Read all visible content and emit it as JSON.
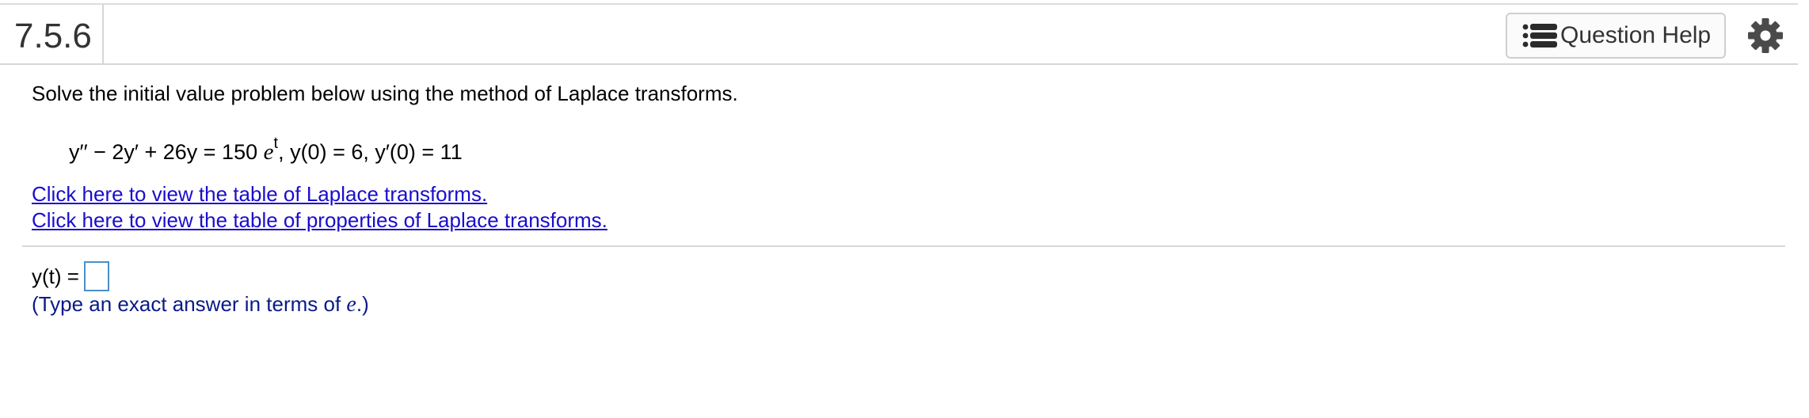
{
  "header": {
    "question_number": "7.5.6",
    "help_label": "Question Help"
  },
  "icons": {
    "help": "list-icon",
    "settings": "gear-icon"
  },
  "colors": {
    "link": "#1a0dcc",
    "hint": "#0a1a88",
    "input_border": "#4a90c9"
  },
  "problem": {
    "instructions": "Solve the initial value problem below using the method of Laplace transforms.",
    "equation": {
      "lhs": "y′′ − 2y′ + 26y = 150",
      "exp_base": "e",
      "exponent": "t",
      "conditions": ", y(0) = 6, y′(0) = 11"
    }
  },
  "links": {
    "laplace_table": "Click here to view the table of Laplace transforms.",
    "properties_table": "Click here to view the table of properties of Laplace transforms."
  },
  "answer": {
    "label": "y(t) =",
    "value": "",
    "hint_prefix": "(Type an exact answer in terms of",
    "hint_var": "e",
    "hint_suffix": ".)"
  }
}
